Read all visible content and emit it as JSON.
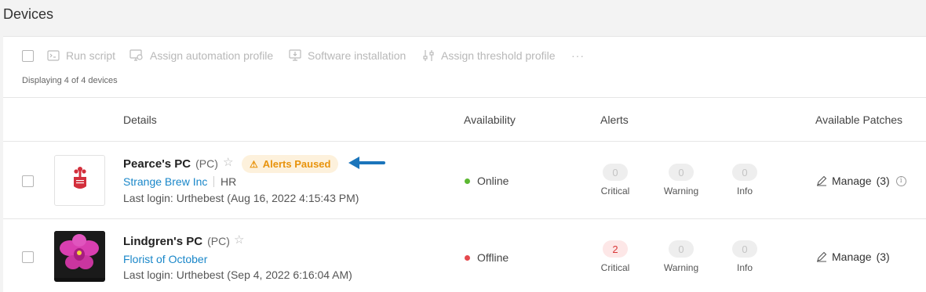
{
  "page": {
    "title": "Devices"
  },
  "toolbar": {
    "run_script": "Run script",
    "assign_automation_profile": "Assign automation profile",
    "software_installation": "Software installation",
    "assign_threshold_profile": "Assign threshold profile",
    "more": "···",
    "displaying": "Displaying 4 of 4 devices"
  },
  "columns": {
    "details": "Details",
    "availability": "Availability",
    "alerts": "Alerts",
    "available_patches": "Available Patches"
  },
  "devices": [
    {
      "name": "Pearce's PC",
      "type": "(PC)",
      "badge": "Alerts Paused",
      "organization": "Strange Brew Inc",
      "department": "HR",
      "last_login": "Last login: Urthebest (Aug 16, 2022 4:15:43 PM)",
      "status": "Online",
      "status_color": "#5cb832",
      "alerts": {
        "critical": "0",
        "warning": "0",
        "info": "0"
      },
      "manage": "Manage",
      "patch_count": "(3)"
    },
    {
      "name": "Lindgren's PC",
      "type": "(PC)",
      "organization": "Florist of October",
      "last_login": "Last login: Urthebest (Sep 4, 2022 6:16:04 AM)",
      "status": "Offline",
      "status_color": "#e5484d",
      "alerts": {
        "critical": "2",
        "warning": "0",
        "info": "0"
      },
      "manage": "Manage",
      "patch_count": "(3)"
    }
  ],
  "alert_labels": {
    "critical": "Critical",
    "warning": "Warning",
    "info": "Info"
  },
  "colors": {
    "link": "#1a87c9",
    "badge_bg": "#fdf1dc",
    "badge_text": "#e8930c",
    "arrow": "#1b75bb"
  }
}
